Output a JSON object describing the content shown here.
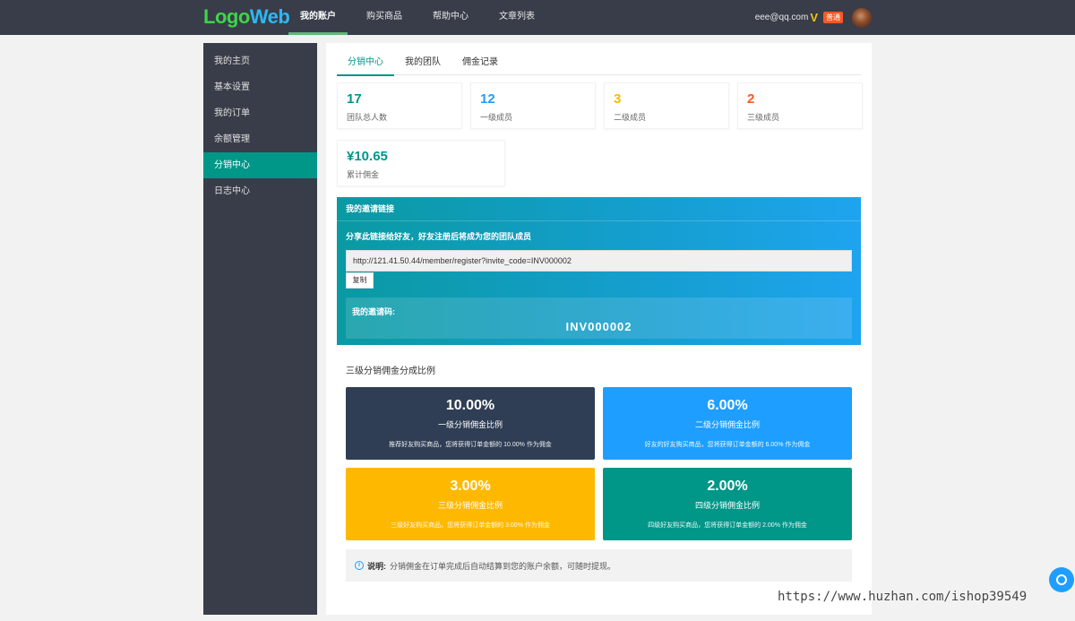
{
  "header": {
    "logo_part1": "Logo",
    "logo_part2": "Web",
    "nav": [
      {
        "label": "我的账户",
        "active": true
      },
      {
        "label": "购买商品",
        "active": false
      },
      {
        "label": "帮助中心",
        "active": false
      },
      {
        "label": "文章列表",
        "active": false
      }
    ],
    "user_email": "eee@qq.com",
    "vip_icon": "V",
    "user_badge": "普通"
  },
  "sidebar": {
    "items": [
      {
        "label": "我的主页"
      },
      {
        "label": "基本设置"
      },
      {
        "label": "我的订单"
      },
      {
        "label": "余额管理"
      },
      {
        "label": "分销中心",
        "active": true
      },
      {
        "label": "日志中心"
      }
    ]
  },
  "tabs": [
    {
      "label": "分销中心",
      "active": true
    },
    {
      "label": "我的团队"
    },
    {
      "label": "佣金记录"
    }
  ],
  "stats": [
    {
      "value": "17",
      "label": "团队总人数",
      "color": "#009688"
    },
    {
      "value": "12",
      "label": "一级成员",
      "color": "#1e9fff"
    },
    {
      "value": "3",
      "label": "二级成员",
      "color": "#ffb800"
    },
    {
      "value": "2",
      "label": "三级成员",
      "color": "#ff5722"
    },
    {
      "value": "¥10.65",
      "label": "累计佣金",
      "color": "#009688"
    }
  ],
  "invite": {
    "title": "我的邀请链接",
    "tip": "分享此链接给好友，好友注册后将成为您的团队成员",
    "link": "http://121.41.50.44/member/register?invite_code=INV000002",
    "copy_label": "复制",
    "code_label": "我的邀请码:",
    "code": "INV000002"
  },
  "ratio": {
    "title": "三级分销佣金分成比例",
    "cards": [
      {
        "pct": "10.00%",
        "name": "一级分销佣金比例",
        "desc": "推荐好友购买商品，您将获得订单金额的 10.00% 作为佣金",
        "color": "#2f3e55"
      },
      {
        "pct": "6.00%",
        "name": "二级分销佣金比例",
        "desc": "好友的好友购买商品，您将获得订单金额的 6.00% 作为佣金",
        "color": "#1e9fff"
      },
      {
        "pct": "3.00%",
        "name": "三级分销佣金比例",
        "desc": "三级好友购买商品，您将获得订单金额的 3.00% 作为佣金",
        "color": "#ffb800"
      },
      {
        "pct": "2.00%",
        "name": "四级分销佣金比例",
        "desc": "四级好友购买商品，您将获得订单金额的 2.00% 作为佣金",
        "color": "#009688"
      }
    ]
  },
  "note": {
    "label": "说明:",
    "text": "分销佣金在订单完成后自动结算到您的账户余额，可随时提现。"
  },
  "watermark": "https://www.huzhan.com/ishop39549"
}
